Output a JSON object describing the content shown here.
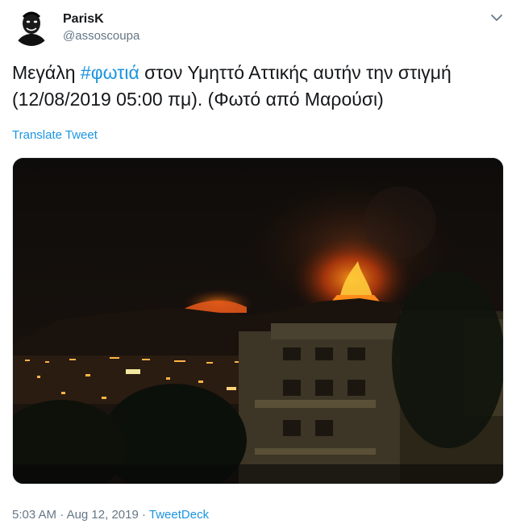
{
  "user": {
    "display_name": "ParisK",
    "handle": "@assoscoupa",
    "avatar_icon": "avatar-face-icon"
  },
  "menu": {
    "icon": "chevron-down-icon"
  },
  "tweet": {
    "text_before": "Μεγάλη ",
    "hashtag": "#φωτιά",
    "text_after": " στον Υμηττό Αττικής αυτήν την στιγμή (12/08/2019 05:00 πμ). (Φωτό από Μαρούσι)",
    "translate_label": "Translate Tweet"
  },
  "media": {
    "type": "photo",
    "subject": "night-fire-on-mountain"
  },
  "meta": {
    "time": "5:03 AM",
    "separator": " · ",
    "date": "Aug 12, 2019",
    "source": "TweetDeck"
  },
  "colors": {
    "link": "#1b95e0",
    "secondary_text": "#657786",
    "primary_text": "#14171a"
  }
}
